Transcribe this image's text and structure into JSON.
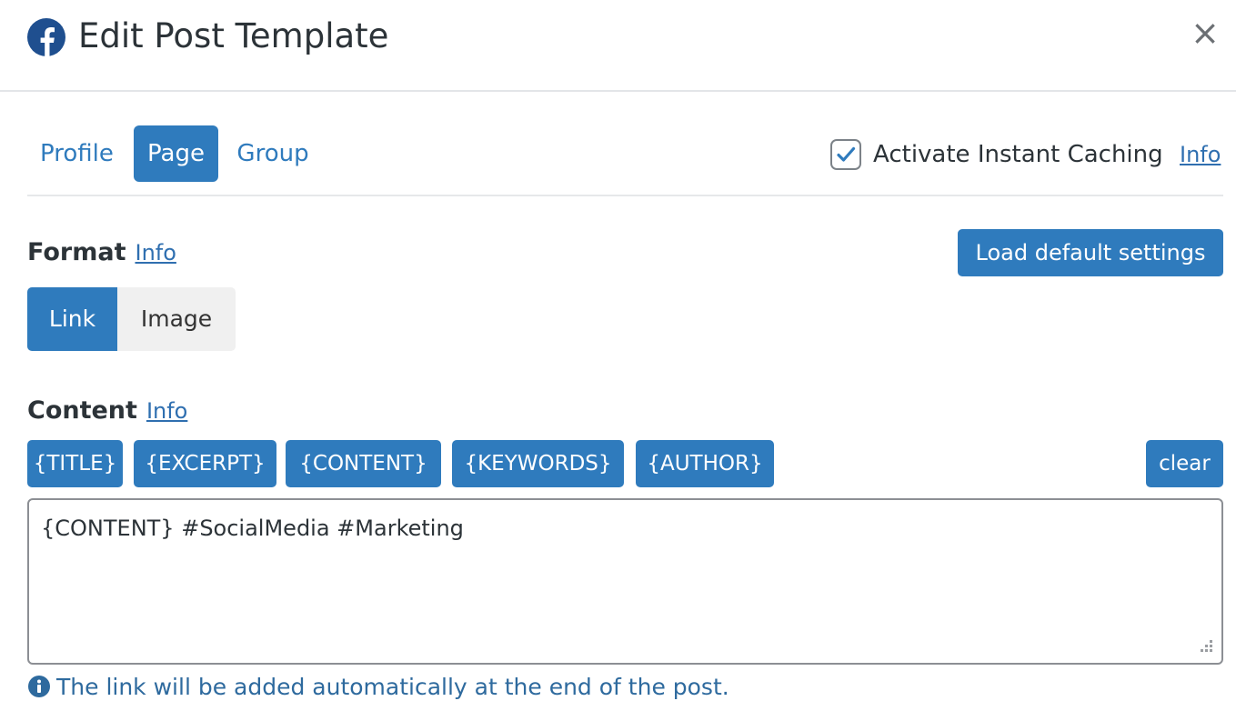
{
  "header": {
    "title": "Edit Post Template",
    "close_symbol": "×",
    "icon": "facebook-icon"
  },
  "tabs": [
    {
      "label": "Profile",
      "active": false
    },
    {
      "label": "Page",
      "active": true
    },
    {
      "label": "Group",
      "active": false
    }
  ],
  "caching": {
    "label": "Activate Instant Caching",
    "checked": true,
    "info_link": "Info"
  },
  "format": {
    "label": "Format",
    "info_link": "Info",
    "load_default_label": "Load default settings",
    "options": [
      {
        "label": "Link",
        "selected": true
      },
      {
        "label": "Image",
        "selected": false
      }
    ]
  },
  "content": {
    "label": "Content",
    "info_link": "Info",
    "tags": [
      "{TITLE}",
      "{EXCERPT}",
      "{CONTENT}",
      "{KEYWORDS}",
      "{AUTHOR}"
    ],
    "clear_label": "clear",
    "value": "{CONTENT} #SocialMedia #Marketing",
    "note": "The link will be added automatically at the end of the post."
  },
  "colors": {
    "accent": "#2f7bbd",
    "link": "#2f6fb0",
    "facebook": "#1f4f8f"
  }
}
